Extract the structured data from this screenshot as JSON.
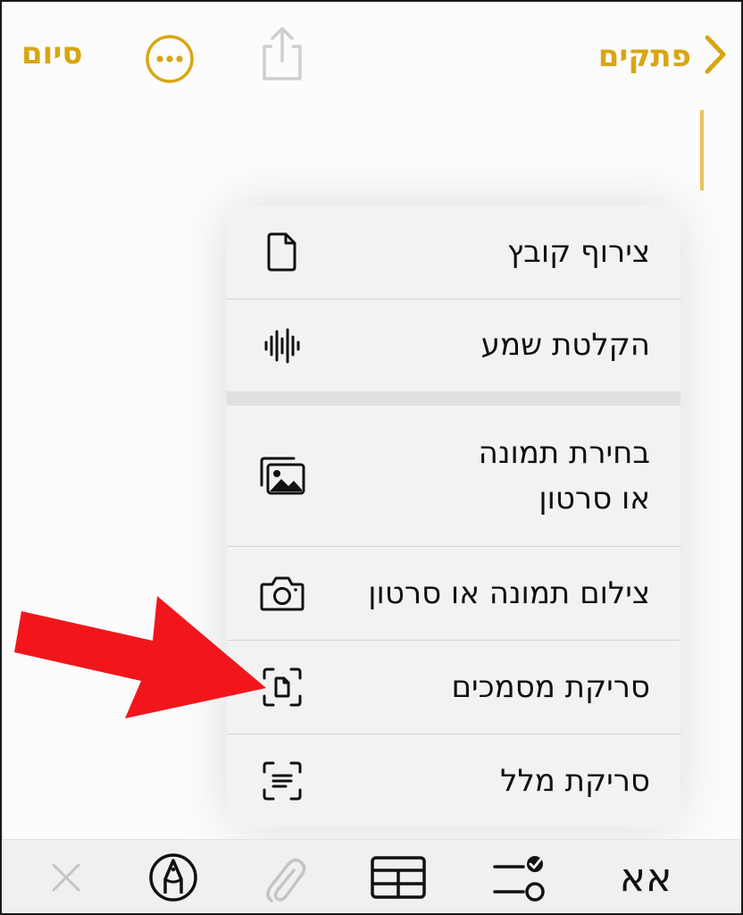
{
  "nav": {
    "back_label": "פתקים",
    "done_label": "סיום",
    "accent_color": "#D9A512",
    "icons": [
      "chevron-right-icon",
      "more-ellipsis-icon",
      "share-icon"
    ]
  },
  "menu": {
    "items": [
      {
        "label": "צירוף קובץ",
        "icon": "document-icon"
      },
      {
        "label": "הקלטת שמע",
        "icon": "waveform-icon"
      },
      {
        "label_line1": "בחירת תמונה",
        "label_line2": "או סרטון",
        "icon": "photo-library-icon"
      },
      {
        "label": "צילום תמונה או סרטון",
        "icon": "camera-icon"
      },
      {
        "label": "סריקת מסמכים",
        "icon": "document-scan-icon"
      },
      {
        "label": "סריקת מלל",
        "icon": "text-scan-icon"
      }
    ]
  },
  "annotation": {
    "arrow_color": "#F2161C",
    "icon": "red-arrow-icon"
  },
  "toolbar": {
    "format_label": "אא",
    "icons": [
      "format-text-icon",
      "checklist-icon",
      "table-icon",
      "attachment-icon",
      "markup-pen-icon",
      "close-icon"
    ]
  }
}
